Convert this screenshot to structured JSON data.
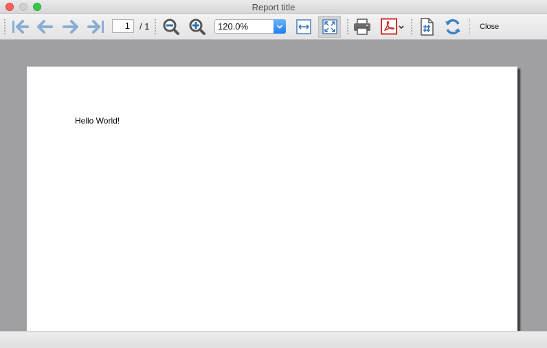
{
  "window": {
    "title": "Report title"
  },
  "toolbar": {
    "page_current": "1",
    "page_total": "/ 1",
    "zoom": "120.0%",
    "close_label": "Close",
    "icons": [
      "first-page-icon",
      "previous-page-icon",
      "next-page-icon",
      "last-page-icon",
      "zoom-out-icon",
      "zoom-in-icon",
      "fit-width-icon",
      "fit-page-icon",
      "print-icon",
      "export-pdf-icon",
      "page-setup-icon",
      "refresh-icon"
    ]
  },
  "document": {
    "text": "Hello World!"
  },
  "colors": {
    "icon_blue": "#8aaed3",
    "pdf_red": "#d0312d",
    "select_blue": "#2b84f5",
    "viewer_background": "#a0a0a3"
  }
}
